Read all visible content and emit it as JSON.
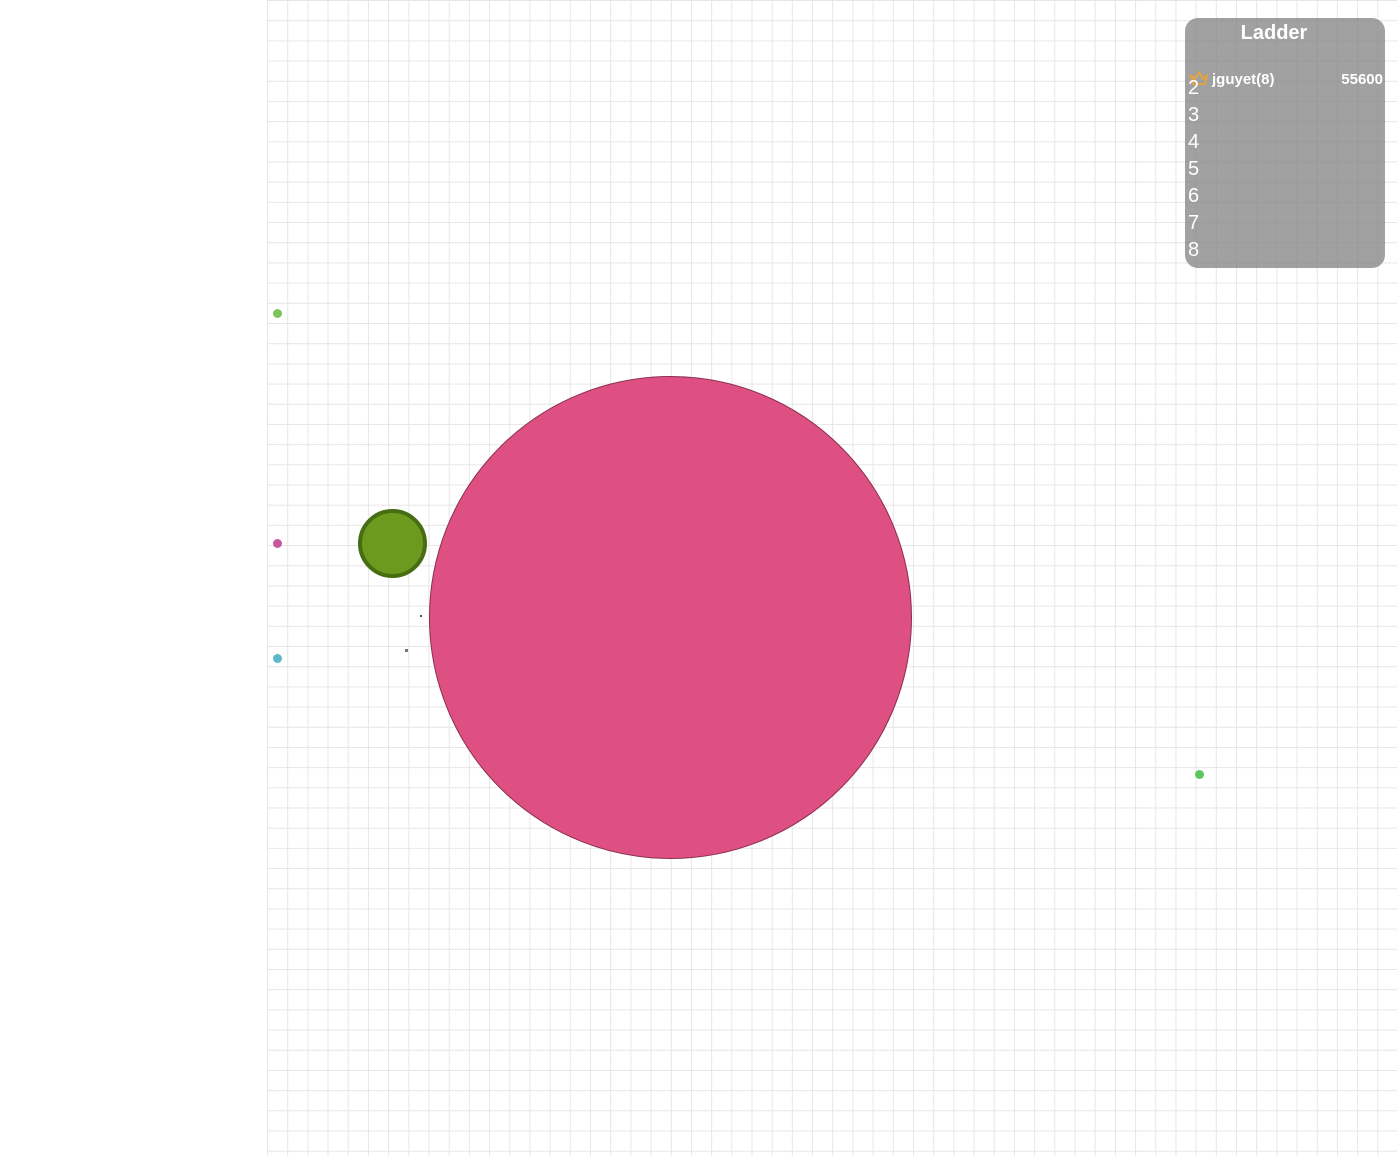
{
  "ladder": {
    "title": "Ladder",
    "leader": {
      "icon": "crown-icon",
      "name": "jguyet(8)",
      "score": "55600"
    },
    "ranks": [
      "2",
      "3",
      "4",
      "5",
      "6",
      "7",
      "8"
    ]
  },
  "colors": {
    "player_cell": "#de5082",
    "virus_cell": "#6b9a1e",
    "food": [
      "#7cc45a",
      "#c9589f",
      "#5ab8c9",
      "#5cc85a"
    ],
    "crown": "#e8a33a"
  }
}
